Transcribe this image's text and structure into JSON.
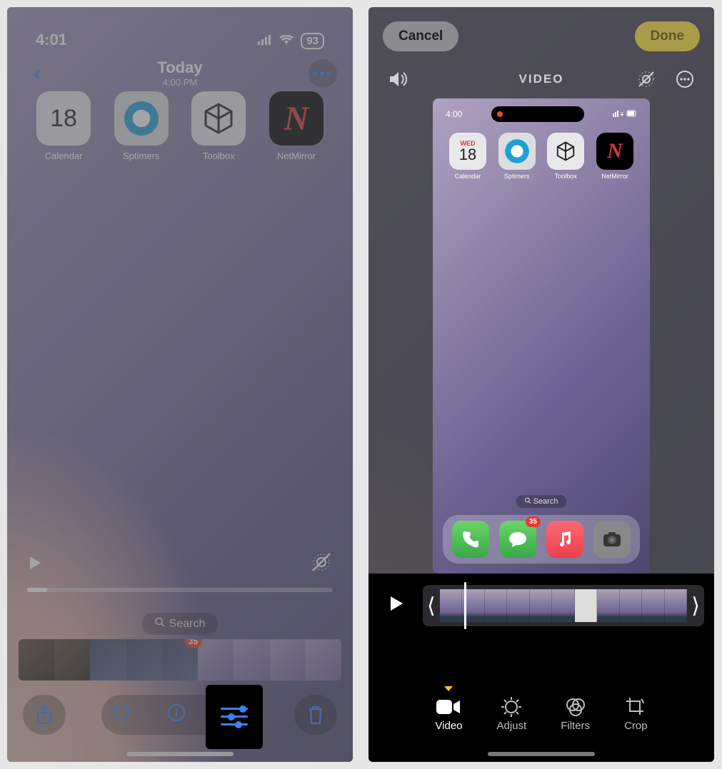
{
  "left": {
    "status": {
      "time": "4:01",
      "battery": "93"
    },
    "header": {
      "title": "Today",
      "subtitle": "4:00 PM"
    },
    "apps": {
      "calendar": {
        "day": "18",
        "label": "Calendar"
      },
      "sptimers": {
        "label": "Sptimers"
      },
      "toolbox": {
        "label": "Toolbox"
      },
      "netmirror": {
        "label": "NetMirror"
      }
    },
    "search_label": "Search",
    "thumbstrip_badge": "35"
  },
  "right": {
    "cancel_label": "Cancel",
    "done_label": "Done",
    "title": "VIDEO",
    "preview": {
      "status_time": "4:00",
      "apps": {
        "calendar": {
          "wed": "WED",
          "day": "18",
          "label": "Calendar"
        },
        "sptimers": {
          "label": "Sptimers"
        },
        "toolbox": {
          "label": "Toolbox"
        },
        "netmirror": {
          "label": "NetMirror"
        }
      },
      "search_label": "Search",
      "msg_badge": "35"
    },
    "modes": {
      "video": "Video",
      "adjust": "Adjust",
      "filters": "Filters",
      "crop": "Crop"
    }
  }
}
